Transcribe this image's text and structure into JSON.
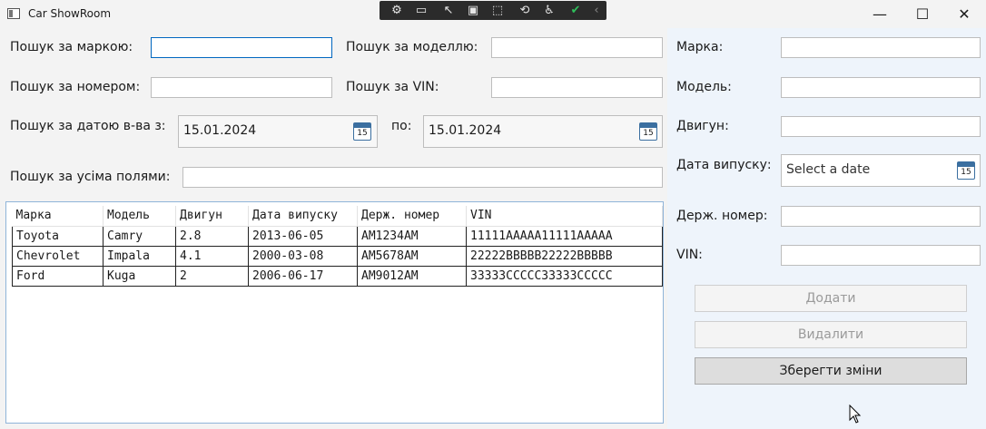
{
  "window": {
    "title": "Car ShowRoom",
    "minimize": "—",
    "maximize": "☐",
    "close": "✕"
  },
  "debug_toolbar": {
    "icons": [
      "select-element-icon",
      "video-icon",
      "pointer-icon",
      "display-layout-icon",
      "track-focus-icon",
      "binding-icon",
      "accessibility-icon",
      "check-icon",
      "collapse-icon"
    ]
  },
  "search": {
    "brand_label": "Пошук за маркою:",
    "brand_value": "",
    "model_label": "Пошук за моделлю:",
    "model_value": "",
    "number_label": "Пошук за номером:",
    "number_value": "",
    "vin_label": "Пошук за VIN:",
    "vin_value": "",
    "date_from_label": "Пошук за датою в-ва з:",
    "date_from_value": "15.01.2024",
    "date_to_label": "по:",
    "date_to_value": "15.01.2024",
    "all_fields_label": "Пошук за усіма полями:",
    "all_fields_value": "",
    "calendar_day": "15"
  },
  "table": {
    "headers": [
      "Марка",
      "Модель",
      "Двигун",
      "Дата випуску",
      "Держ. номер",
      "VIN"
    ],
    "rows": [
      [
        "Toyota",
        "Camry",
        "2.8",
        "2013-06-05",
        "AM1234AM",
        "11111AAAAA11111AAAAA"
      ],
      [
        "Chevrolet",
        "Impala",
        "4.1",
        "2000-03-08",
        "AM5678AM",
        "22222BBBBB22222BBBBB"
      ],
      [
        "Ford",
        "Kuga",
        "2",
        "2006-06-17",
        "AM9012AM",
        "33333CCCCC33333CCCCC"
      ]
    ]
  },
  "form": {
    "brand_label": "Марка:",
    "brand_value": "",
    "model_label": "Модель:",
    "model_value": "",
    "engine_label": "Двигун:",
    "engine_value": "",
    "release_label": "Дата випуску:",
    "release_placeholder": "Select a date",
    "plate_label": "Держ. номер:",
    "plate_value": "",
    "vin_label": "VIN:",
    "vin_value": "",
    "calendar_day": "15"
  },
  "buttons": {
    "add": "Додати",
    "delete": "Видалити",
    "save": "Зберегти зміни"
  },
  "colors": {
    "accent": "#0067c0",
    "panel": "#eef4fb",
    "grid_border": "#8fb4d9"
  }
}
